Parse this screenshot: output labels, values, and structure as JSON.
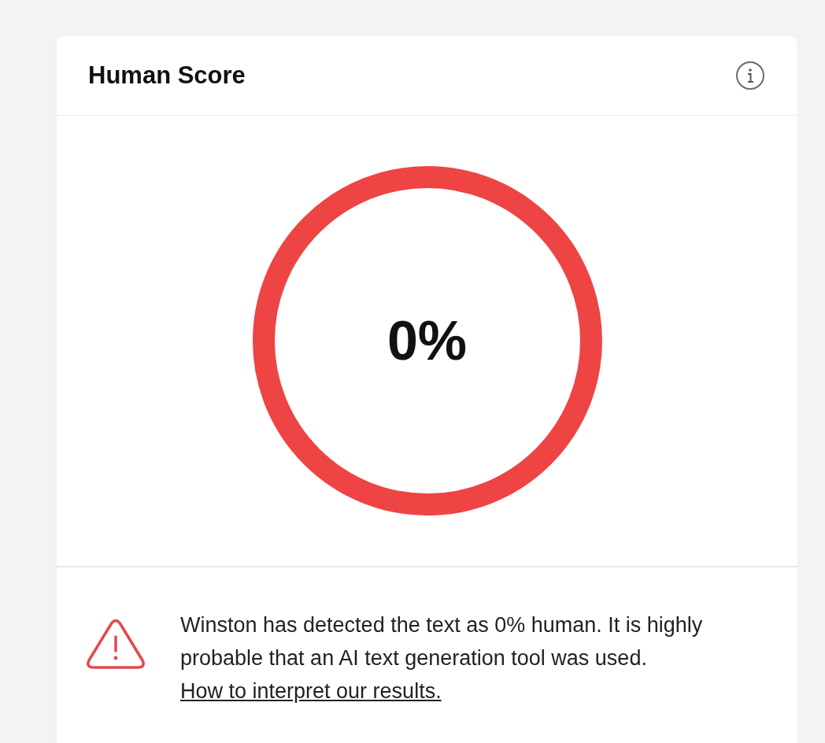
{
  "card": {
    "title": "Human Score",
    "gauge": {
      "reading": "0%"
    },
    "message": {
      "text": "Winston has detected the text as 0% human. It is highly probable that an AI text generation tool was used.",
      "link": "How to interpret our results."
    }
  }
}
